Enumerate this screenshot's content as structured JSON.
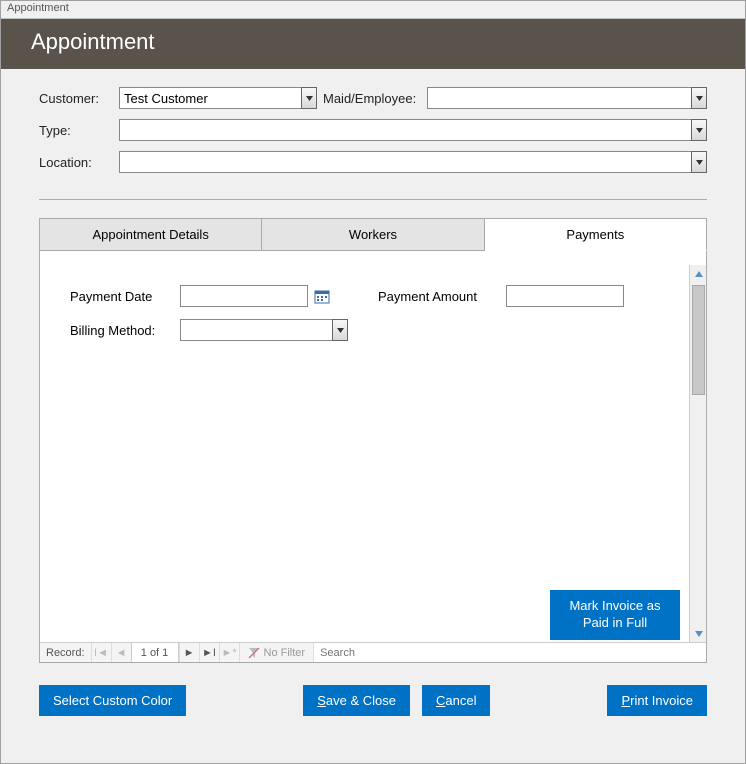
{
  "window": {
    "title": "Appointment"
  },
  "header": {
    "title": "Appointment"
  },
  "form": {
    "customer_label": "Customer:",
    "customer_value": "Test Customer",
    "maid_label": "Maid/Employee:",
    "maid_value": "",
    "type_label": "Type:",
    "type_value": "",
    "location_label": "Location:",
    "location_value": ""
  },
  "tabs": [
    {
      "label": "Appointment Details",
      "active": false
    },
    {
      "label": "Workers",
      "active": false
    },
    {
      "label": "Payments",
      "active": true
    }
  ],
  "payments": {
    "date_label": "Payment Date",
    "date_value": "",
    "amount_label": "Payment Amount",
    "amount_value": "",
    "billing_label": "Billing Method:",
    "billing_value": "",
    "mark_paid_label": "Mark Invoice as Paid in Full"
  },
  "recordbar": {
    "label": "Record:",
    "position": "1 of 1",
    "nofilter": "No Filter",
    "search_placeholder": "Search"
  },
  "footer": {
    "custom_color": "Select Custom Color",
    "save_close": "Save & Close",
    "cancel": "Cancel",
    "print_invoice": "Print Invoice"
  }
}
